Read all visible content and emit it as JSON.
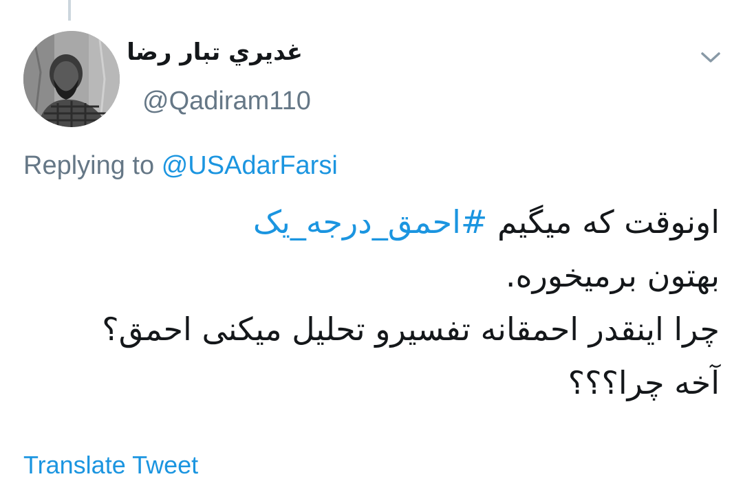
{
  "colors": {
    "accent": "#1b95e0",
    "secondary_text": "#657786",
    "primary_text": "#14171a",
    "thread_line": "#ccd6dd"
  },
  "author": {
    "display_name": "غديري تبار رضا",
    "handle": "@Qadiram110",
    "avatar_icon": "profile-photo"
  },
  "menu": {
    "icon": "chevron-down-icon"
  },
  "reply": {
    "prefix": "Replying to",
    "mention": "@USAdarFarsi"
  },
  "tweet": {
    "line1_text": "اونوقت که میگیم",
    "line1_hashtag": "#احمق_درجه_یک",
    "line2": "بهتون برمیخوره.",
    "line3": "چرا اینقدر احمقانه تفسیرو تحلیل میکنی احمق؟",
    "line4": "آخه چرا؟؟؟"
  },
  "actions": {
    "translate_label": "Translate Tweet"
  }
}
